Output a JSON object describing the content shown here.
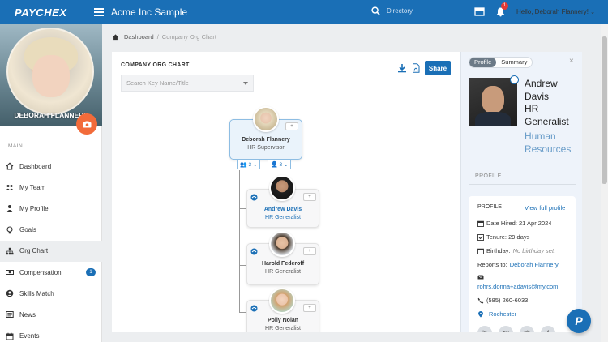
{
  "header": {
    "logo": "PAYCHEX",
    "app_title": "Acme Inc Sample",
    "search_placeholder": "Directory",
    "notification_count": "1",
    "greeting": "Hello, Deborah Flannery!"
  },
  "sidebar": {
    "user_name": "DEBORAH FLANNERY",
    "section_label": "MAIN",
    "items": [
      {
        "label": "Dashboard",
        "icon": "home-icon"
      },
      {
        "label": "My Team",
        "icon": "team-icon"
      },
      {
        "label": "My Profile",
        "icon": "user-icon"
      },
      {
        "label": "Goals",
        "icon": "bulb-icon"
      },
      {
        "label": "Org Chart",
        "icon": "org-chart-icon"
      },
      {
        "label": "Compensation",
        "icon": "money-icon",
        "badge": "1"
      },
      {
        "label": "Skills Match",
        "icon": "user-circle-icon"
      },
      {
        "label": "News",
        "icon": "newspaper-icon"
      },
      {
        "label": "Events",
        "icon": "calendar-icon"
      }
    ]
  },
  "breadcrumb": {
    "home": "Dashboard",
    "separator": "/",
    "current": "Company Org Chart"
  },
  "org_chart": {
    "title": "COMPANY ORG CHART",
    "search_placeholder": "Search Key Name/Title",
    "share_label": "Share",
    "add_label": "+",
    "root": {
      "name": "Deborah Flannery",
      "title": "HR Supervisor",
      "team_count": "3",
      "direct_count": "3"
    },
    "children": [
      {
        "name": "Andrew Davis",
        "title": "HR Generalist"
      },
      {
        "name": "Harold Federoff",
        "title": "HR Generalist"
      },
      {
        "name": "Polly Nolan",
        "title": "HR Generalist"
      }
    ]
  },
  "profile_panel": {
    "tabs": [
      "Profile",
      "Summary"
    ],
    "close": "×",
    "name_line1": "Andrew",
    "name_line2": "Davis",
    "title_line1": "HR",
    "title_line2": "Generalist",
    "dept_line1": "Human",
    "dept_line2": "Resources",
    "section_label": "PROFILE",
    "card_head": "PROFILE",
    "view_full": "View full profile",
    "date_hired": "Date Hired: 21 Apr 2024",
    "tenure": "Tenure: 29 days",
    "birthday_label": "Birthday:",
    "birthday_value": "No birthday set.",
    "reports_label": "Reports to:",
    "reports_value": "Deborah Flannery",
    "email": "rohrs.donna+adavis@my.com",
    "phone": "(585) 260-6033",
    "location": "Rochester",
    "social": [
      "in",
      "tw",
      "gh",
      "f"
    ]
  },
  "help": {
    "label": "P"
  },
  "colors": {
    "primary": "#1a6fb6",
    "accent": "#f26b3a"
  }
}
